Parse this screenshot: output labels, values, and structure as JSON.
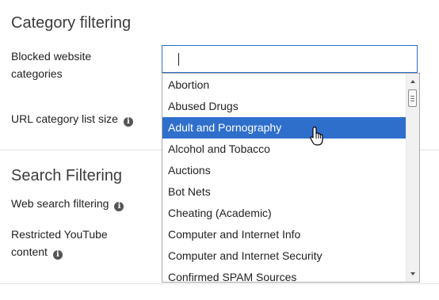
{
  "sections": {
    "category_title": "Category filtering",
    "search_title": "Search Filtering"
  },
  "fields": {
    "blocked_label_line1": "Blocked website",
    "blocked_label_line2": "categories",
    "url_list_size_label": "URL category list size",
    "web_search_label": "Web search filtering",
    "youtube_label_line1": "Restricted YouTube",
    "youtube_label_line2": "content"
  },
  "search": {
    "value": ""
  },
  "dropdown": {
    "selected_index": 2,
    "options": [
      "Abortion",
      "Abused Drugs",
      "Adult and Pornography",
      "Alcohol and Tobacco",
      "Auctions",
      "Bot Nets",
      "Cheating (Academic)",
      "Computer and Internet Info",
      "Computer and Internet Security",
      "Confirmed SPAM Sources"
    ]
  },
  "icons": {
    "info": "info-icon",
    "cursor": "hand-pointer-icon"
  },
  "colors": {
    "accent": "#2f6fcc",
    "icon": "#555555"
  }
}
